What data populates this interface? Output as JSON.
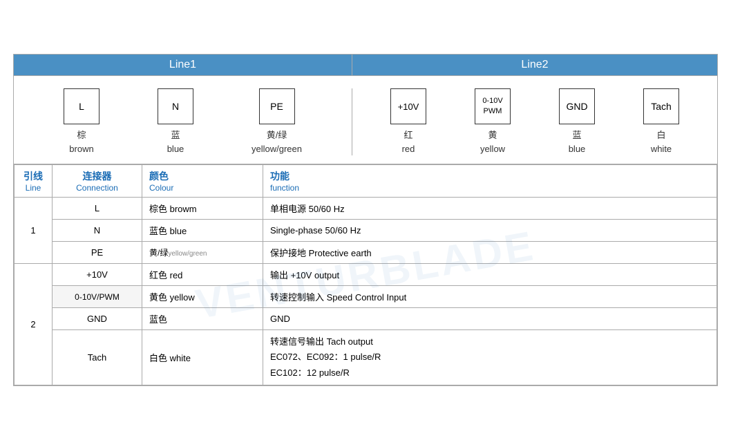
{
  "header": {
    "line1_label": "Line1",
    "line2_label": "Line2"
  },
  "line1_connectors": [
    {
      "id": "L",
      "label_zh": "棕",
      "label_en": "brown"
    },
    {
      "id": "N",
      "label_zh": "蓝",
      "label_en": "blue"
    },
    {
      "id": "PE",
      "label_zh": "黄/绿",
      "label_en": "yellow/green"
    }
  ],
  "line2_connectors": [
    {
      "id": "+10V",
      "label_zh": "红",
      "label_en": "red"
    },
    {
      "id": "0-10V\nPWM",
      "label_zh": "黄",
      "label_en": "yellow"
    },
    {
      "id": "GND",
      "label_zh": "蓝",
      "label_en": "blue"
    },
    {
      "id": "Tach",
      "label_zh": "白",
      "label_en": "white"
    }
  ],
  "table": {
    "headers": {
      "line_zh": "引线",
      "line_en": "Line",
      "connection_zh": "连接器",
      "connection_en": "Connection",
      "colour_zh": "颜色",
      "colour_en": "Colour",
      "function_zh": "功能",
      "function_en": "function"
    },
    "rows": [
      {
        "line": "1",
        "line_rowspan": 3,
        "connections": [
          {
            "connection": "L",
            "colour": "棕色 browm",
            "function": "单相电源 50/60 Hz"
          },
          {
            "connection": "N",
            "colour": "蓝色 blue",
            "function": "Single-phase 50/60 Hz"
          },
          {
            "connection": "PE",
            "colour": "黄/绿 yellow/green",
            "function": "保护接地 Protective earth"
          }
        ]
      },
      {
        "line": "2",
        "line_rowspan": 4,
        "connections": [
          {
            "connection": "+10V",
            "colour": "红色 red",
            "function": "输出 +10V output"
          },
          {
            "connection": "0-10V/PWM",
            "colour": "黄色 yellow",
            "function": "转速控制输入 Speed Control Input"
          },
          {
            "connection": "GND",
            "colour": "蓝色",
            "function": "GND"
          },
          {
            "connection": "Tach",
            "colour": "白色 white",
            "function": "转速信号输出 Tach output\nEC072、EC092：1 pulse/R\nEC102：12 pulse/R"
          }
        ]
      }
    ]
  }
}
